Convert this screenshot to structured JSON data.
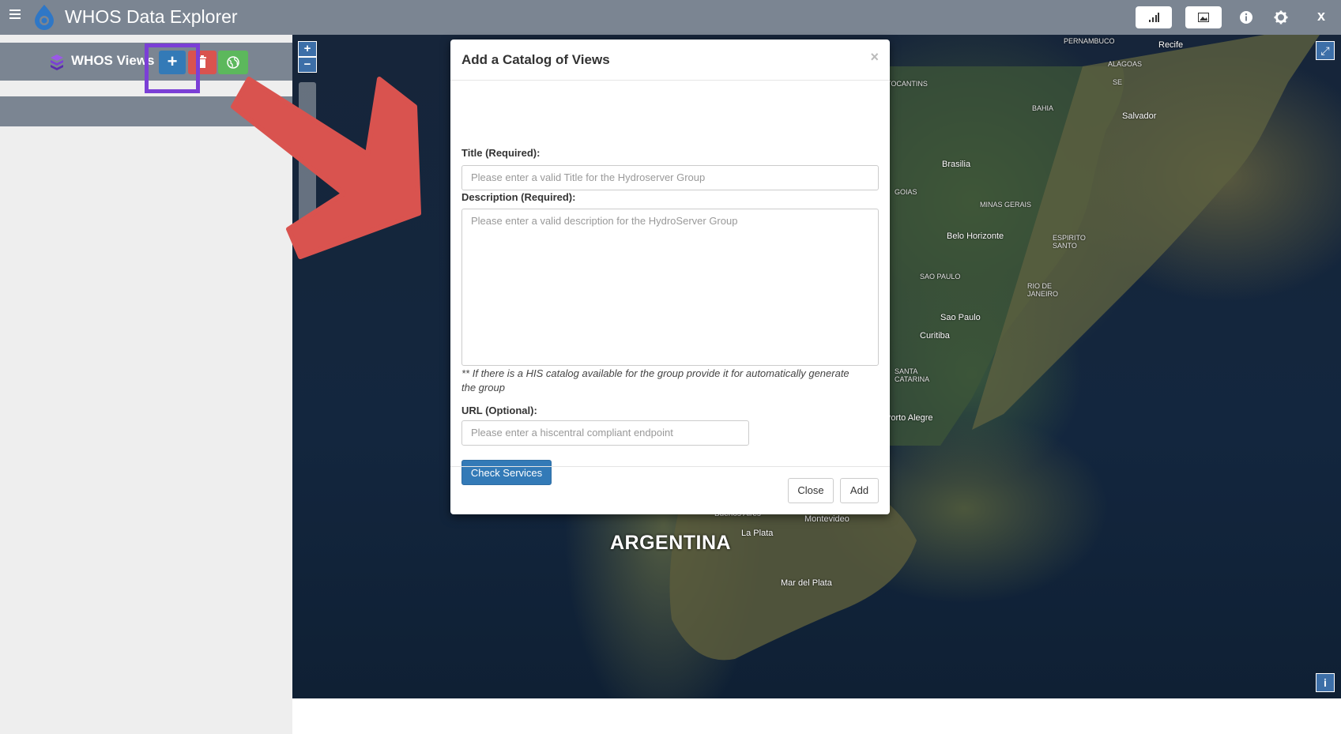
{
  "app": {
    "title": "WHOS Data Explorer",
    "close_label": "x"
  },
  "topbar_icons": [
    "chart-icon",
    "image-icon",
    "info-icon",
    "gear-icon"
  ],
  "sidebar": {
    "views_title": "WHOS Views",
    "add_label": "+"
  },
  "map": {
    "zoom_in": "+",
    "zoom_out": "−",
    "fullscreen": "⤢",
    "info": "i",
    "country_label": "ARGENTINA",
    "places": [
      "Recife",
      "Salvador",
      "Brasilia",
      "Belo Horizonte",
      "Sao Paulo",
      "Curitiba",
      "Porto Alegre",
      "Montevideo",
      "La Plata",
      "Mar del Plata",
      "Buenos Aires"
    ],
    "regions": [
      "PERNAMBUCO",
      "ALAGOAS",
      "SE",
      "TOCANTINS",
      "BAHIA",
      "GOIAS",
      "MINAS GERAIS",
      "ESPIRITO SANTO",
      "SAO PAULO",
      "RIO DE JANEIRO",
      "SANTA CATARINA"
    ]
  },
  "modal": {
    "title": "Add a Catalog of Views",
    "close_x": "×",
    "title_label": "Title (Required):",
    "title_placeholder": "Please enter a valid Title for the Hydroserver Group",
    "description_label": "Description (Required):",
    "description_placeholder": "Please enter a valid description for the HydroServer Group",
    "note": "** If there is a HIS catalog available for the group provide it for automatically generate the group",
    "url_label": "URL (Optional):",
    "url_placeholder": "Please enter a hiscentral compliant endpoint",
    "check_button": "Check Services",
    "close_button": "Close",
    "add_button": "Add"
  },
  "colors": {
    "topbar": "#7b8592",
    "primary": "#337ab7",
    "danger": "#d9534f",
    "success": "#5cb85c",
    "highlight": "#7b3fd6",
    "arrow": "#d9534f"
  }
}
